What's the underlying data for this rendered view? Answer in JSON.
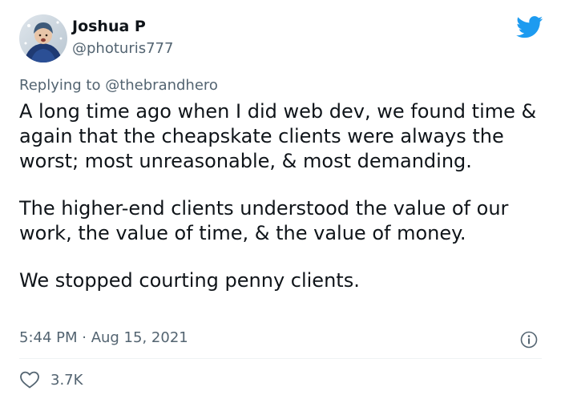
{
  "author": {
    "name": "Joshua P",
    "handle": "@photuris777"
  },
  "reply": {
    "prefix": "Replying to ",
    "mention": "@thebrandhero"
  },
  "tweet": {
    "paragraphs": [
      "A long time ago when I did web dev, we found time & again that the cheapskate clients were always the worst; most unreasonable, & most demanding.",
      "The higher-end clients understood the value of our work, the value of time, & the value of money.",
      "We stopped courting penny clients."
    ],
    "timestamp": "5:44 PM · Aug 15, 2021"
  },
  "engagement": {
    "likes": "3.7K"
  },
  "icons": {
    "logo": "twitter-bird-icon",
    "info": "info-icon",
    "like": "heart-icon"
  },
  "colors": {
    "twitter_blue": "#1d9bf0",
    "secondary_text": "#536471",
    "primary_text": "#0f1419"
  }
}
